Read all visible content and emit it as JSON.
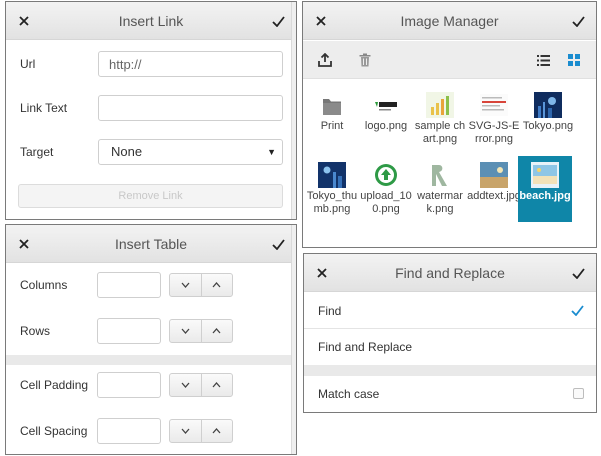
{
  "insert_link": {
    "title": "Insert Link",
    "url_label": "Url",
    "url_value": "http://",
    "link_text_label": "Link Text",
    "link_text_value": "",
    "target_label": "Target",
    "target_value": "None",
    "remove_link_label": "Remove Link"
  },
  "image_manager": {
    "title": "Image Manager",
    "files": [
      {
        "name": "Print",
        "icon": "folder-icon"
      },
      {
        "name": "logo.png",
        "icon": "image-thumb"
      },
      {
        "name": "sample chart.png",
        "icon": "image-thumb"
      },
      {
        "name": "SVG-JS-Error.png",
        "icon": "image-thumb"
      },
      {
        "name": "Tokyo.png",
        "icon": "image-thumb"
      },
      {
        "name": "Tokyo_thumb.png",
        "icon": "image-thumb"
      },
      {
        "name": "upload_100.png",
        "icon": "image-thumb"
      },
      {
        "name": "watermark.png",
        "icon": "image-thumb"
      },
      {
        "name": "addtext.jpg",
        "icon": "image-thumb"
      },
      {
        "name": "beach.jpg",
        "icon": "image-thumb",
        "selected": true
      }
    ]
  },
  "insert_table": {
    "title": "Insert Table",
    "columns_label": "Columns",
    "rows_label": "Rows",
    "cell_padding_label": "Cell Padding",
    "cell_spacing_label": "Cell Spacing"
  },
  "find_replace": {
    "title": "Find and Replace",
    "find_label": "Find",
    "find_replace_label": "Find and Replace",
    "match_case_label": "Match case"
  },
  "colors": {
    "selected_tile": "#0f86a8",
    "check_accent": "#1a8ccf"
  }
}
